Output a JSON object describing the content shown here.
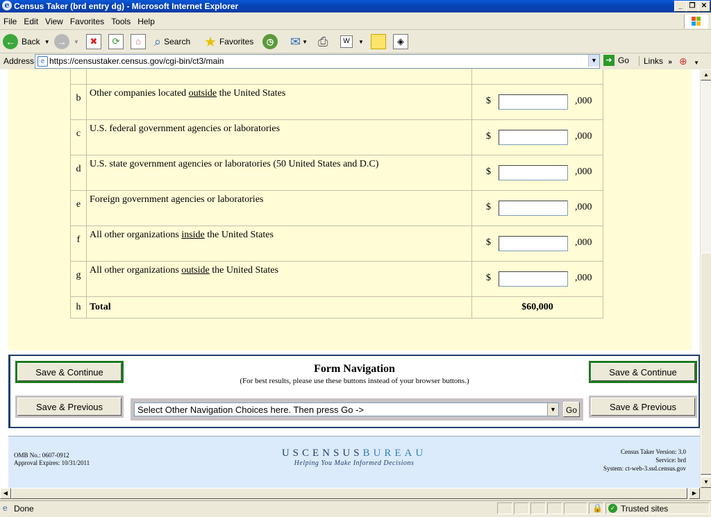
{
  "window": {
    "title": "Census Taker (brd entry dg) - Microsoft Internet Explorer"
  },
  "menu": [
    "File",
    "Edit",
    "View",
    "Favorites",
    "Tools",
    "Help"
  ],
  "toolbar": {
    "back": "Back",
    "search": "Search",
    "favorites": "Favorites"
  },
  "address": {
    "label": "Address",
    "url": "https://censustaker.census.gov/cgi-bin/ct3/main",
    "go": "Go",
    "links": "Links"
  },
  "rows": [
    {
      "letter": "",
      "pre": "",
      "em": "",
      "post": "",
      "currency": "$",
      "suffix": ",000"
    },
    {
      "letter": "b",
      "pre": "Other companies located ",
      "em": "outside",
      "post": " the United States",
      "currency": "$",
      "suffix": ",000"
    },
    {
      "letter": "c",
      "pre": "U.S. federal government agencies or laboratories",
      "em": "",
      "post": "",
      "currency": "$",
      "suffix": ",000"
    },
    {
      "letter": "d",
      "pre": "U.S. state government agencies or laboratories (50 United States and D.C)",
      "em": "",
      "post": "",
      "currency": "$",
      "suffix": ",000"
    },
    {
      "letter": "e",
      "pre": "Foreign government agencies or laboratories",
      "em": "",
      "post": "",
      "currency": "$",
      "suffix": ",000"
    },
    {
      "letter": "f",
      "pre": "All other organizations ",
      "em": "inside",
      "post": " the United States",
      "currency": "$",
      "suffix": ",000"
    },
    {
      "letter": "g",
      "pre": "All other organizations ",
      "em": "outside",
      "post": " the United States",
      "currency": "$",
      "suffix": ",000"
    }
  ],
  "total": {
    "letter": "h",
    "label": "Total",
    "value": "$60,000"
  },
  "nav": {
    "title": "Form Navigation",
    "subtitle": "(For best results, please use these buttons instead of your browser buttons.)",
    "save_continue": "Save & Continue",
    "save_previous": "Save & Previous",
    "select_value": "Select Other Navigation Choices here. Then press Go ->",
    "go": "Go"
  },
  "footer": {
    "omb": "OMB No.: 0607-0912",
    "expires": "Approval Expires: 10/31/2011",
    "logo_a": "USCENSUS",
    "logo_b": "BUREAU",
    "tagline": "Helping You Make Informed Decisions",
    "version": "Census Taker Version: 3.0",
    "service": "Service: brd",
    "system": "System: ct-web-3.ssd.census.gov"
  },
  "status": {
    "left": "Done",
    "zone": "Trusted sites"
  }
}
